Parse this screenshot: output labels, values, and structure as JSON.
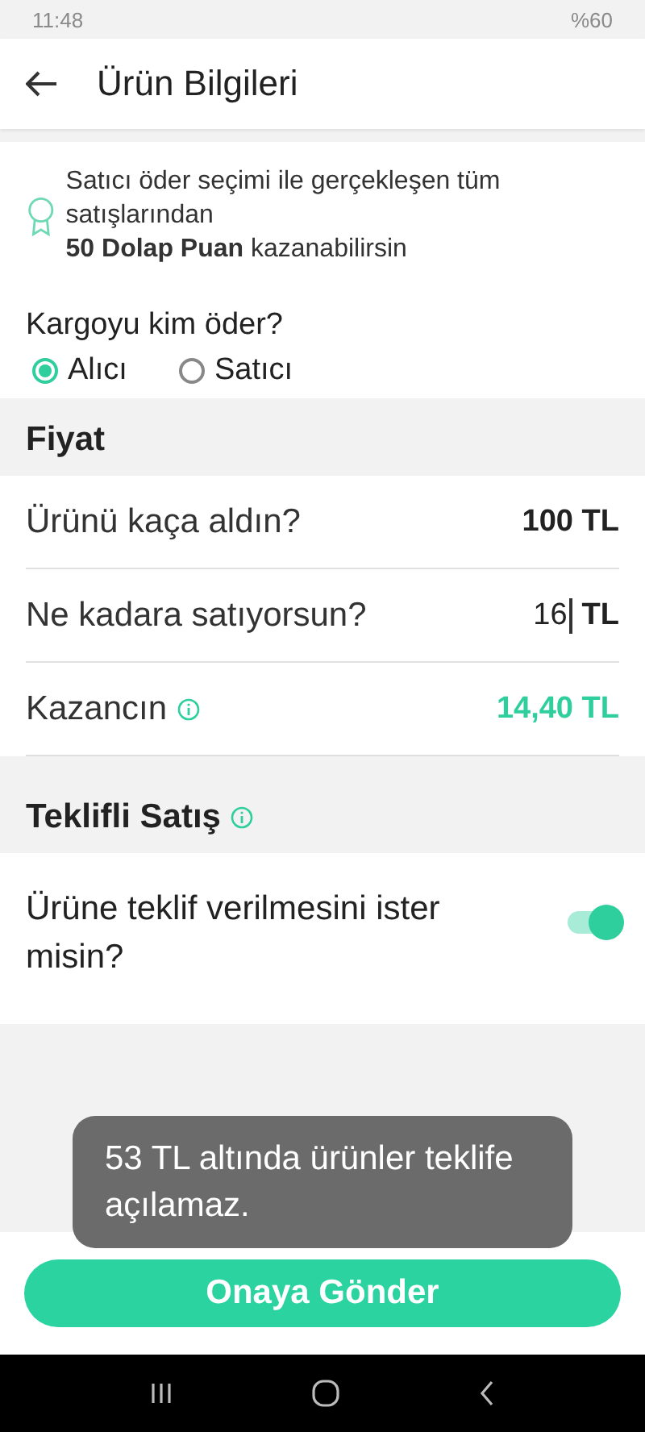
{
  "status_bar": {
    "time": "11:48",
    "battery": "%60"
  },
  "app_bar": {
    "title": "Ürün Bilgileri"
  },
  "reward": {
    "text": "Satıcı öder seçimi ile gerçekleşen tüm satışlarından\n**50 Dolap Puan** kazanabilirsin"
  },
  "shipping": {
    "question": "Kargoyu kim öder?",
    "options": [
      {
        "label": "Alıcı",
        "selected": true
      },
      {
        "label": "Satıcı",
        "selected": false
      }
    ]
  },
  "price": {
    "title": "Fiyat",
    "rows": [
      {
        "kind": "value",
        "label": "Ürünü kaça aldın?",
        "value": "100 TL"
      },
      {
        "kind": "input",
        "label": "Ne kadara satıyorsun?",
        "value": "16",
        "unit": "TL"
      },
      {
        "kind": "earning",
        "label": "Kazancın",
        "value": "14,40 TL"
      }
    ]
  },
  "offer": {
    "title": "Teklifli Satış",
    "question": "Ürüne teklif verilmesini ister misin?",
    "on": true
  },
  "toast": "53 TL altında ürünler teklife açılamaz.",
  "submit": "Onaya Gönder"
}
